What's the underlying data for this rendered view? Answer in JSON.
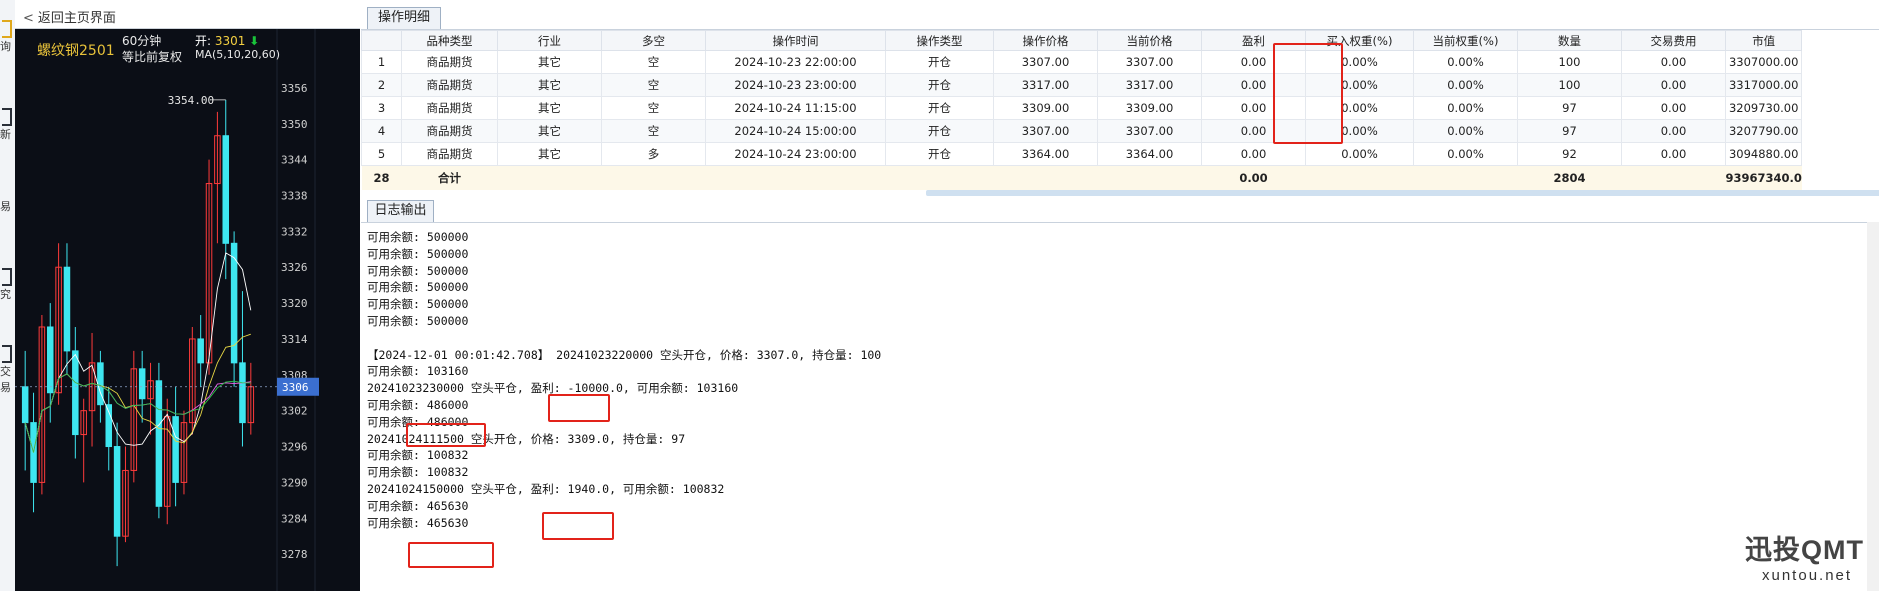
{
  "nav": {
    "back_label": "返回主页界面"
  },
  "sidebar": {
    "labels": [
      "询",
      "新",
      "易",
      "究",
      "交易"
    ]
  },
  "chart": {
    "symbol": "螺纹钢2501",
    "period": "60分钟",
    "adjust": "等比前复权",
    "open_label": "开:",
    "open_value": "3301",
    "open_arrow": "⬇",
    "ma_label": "MA(5,10,20,60)",
    "peak_label": "3354.00",
    "current_price_label": "3306",
    "colors": {
      "up": "#ff3b3b",
      "down": "#3ee6f0",
      "axis_text": "#d0d0d0",
      "current_box": "#3b6fd0"
    }
  },
  "chart_data": {
    "type": "candlestick",
    "title": "螺纹钢2501",
    "y_ticks": [
      3356,
      3350,
      3344,
      3338,
      3332,
      3326,
      3320,
      3314,
      3308,
      3302,
      3296,
      3290,
      3284,
      3278
    ],
    "ylim": [
      3273,
      3360
    ],
    "series_ma": [
      "MA5",
      "MA10",
      "MA20",
      "MA60"
    ],
    "candles": [
      {
        "o": 3306,
        "h": 3312,
        "l": 3292,
        "c": 3300
      },
      {
        "o": 3300,
        "h": 3305,
        "l": 3285,
        "c": 3290
      },
      {
        "o": 3290,
        "h": 3318,
        "l": 3288,
        "c": 3316
      },
      {
        "o": 3316,
        "h": 3320,
        "l": 3300,
        "c": 3305
      },
      {
        "o": 3305,
        "h": 3330,
        "l": 3303,
        "c": 3326
      },
      {
        "o": 3326,
        "h": 3330,
        "l": 3308,
        "c": 3312
      },
      {
        "o": 3312,
        "h": 3316,
        "l": 3294,
        "c": 3298
      },
      {
        "o": 3298,
        "h": 3304,
        "l": 3290,
        "c": 3302
      },
      {
        "o": 3302,
        "h": 3315,
        "l": 3296,
        "c": 3310
      },
      {
        "o": 3310,
        "h": 3312,
        "l": 3300,
        "c": 3303
      },
      {
        "o": 3303,
        "h": 3306,
        "l": 3292,
        "c": 3296
      },
      {
        "o": 3296,
        "h": 3300,
        "l": 3276,
        "c": 3281
      },
      {
        "o": 3281,
        "h": 3296,
        "l": 3280,
        "c": 3292
      },
      {
        "o": 3292,
        "h": 3312,
        "l": 3290,
        "c": 3309
      },
      {
        "o": 3309,
        "h": 3312,
        "l": 3300,
        "c": 3304
      },
      {
        "o": 3304,
        "h": 3310,
        "l": 3298,
        "c": 3307
      },
      {
        "o": 3307,
        "h": 3310,
        "l": 3284,
        "c": 3286
      },
      {
        "o": 3286,
        "h": 3304,
        "l": 3283,
        "c": 3301
      },
      {
        "o": 3301,
        "h": 3306,
        "l": 3286,
        "c": 3290
      },
      {
        "o": 3290,
        "h": 3302,
        "l": 3288,
        "c": 3300
      },
      {
        "o": 3300,
        "h": 3316,
        "l": 3298,
        "c": 3314
      },
      {
        "o": 3314,
        "h": 3318,
        "l": 3306,
        "c": 3310
      },
      {
        "o": 3310,
        "h": 3344,
        "l": 3308,
        "c": 3340
      },
      {
        "o": 3340,
        "h": 3352,
        "l": 3330,
        "c": 3348
      },
      {
        "o": 3348,
        "h": 3354,
        "l": 3324,
        "c": 3330
      },
      {
        "o": 3330,
        "h": 3332,
        "l": 3306,
        "c": 3310
      },
      {
        "o": 3310,
        "h": 3322,
        "l": 3296,
        "c": 3300
      },
      {
        "o": 3300,
        "h": 3310,
        "l": 3298,
        "c": 3306
      }
    ]
  },
  "ops": {
    "tab_label": "操作明细",
    "columns": [
      "",
      "品种类型",
      "行业",
      "多空",
      "操作时间",
      "操作类型",
      "操作价格",
      "当前价格",
      "盈利",
      "买入权重(%)",
      "当前权重(%)",
      "数量",
      "交易费用",
      "市值"
    ],
    "rows": [
      [
        "1",
        "商品期货",
        "其它",
        "空",
        "2024-10-23 22:00:00",
        "开仓",
        "3307.00",
        "3307.00",
        "0.00",
        "0.00%",
        "0.00%",
        "100",
        "0.00",
        "3307000.00"
      ],
      [
        "2",
        "商品期货",
        "其它",
        "空",
        "2024-10-23 23:00:00",
        "开仓",
        "3317.00",
        "3317.00",
        "0.00",
        "0.00%",
        "0.00%",
        "100",
        "0.00",
        "3317000.00"
      ],
      [
        "3",
        "商品期货",
        "其它",
        "空",
        "2024-10-24 11:15:00",
        "开仓",
        "3309.00",
        "3309.00",
        "0.00",
        "0.00%",
        "0.00%",
        "97",
        "0.00",
        "3209730.00"
      ],
      [
        "4",
        "商品期货",
        "其它",
        "空",
        "2024-10-24 15:00:00",
        "开仓",
        "3307.00",
        "3307.00",
        "0.00",
        "0.00%",
        "0.00%",
        "97",
        "0.00",
        "3207790.00"
      ],
      [
        "5",
        "商品期货",
        "其它",
        "多",
        "2024-10-24 23:00:00",
        "开仓",
        "3364.00",
        "3364.00",
        "0.00",
        "0.00%",
        "0.00%",
        "92",
        "0.00",
        "3094880.00"
      ]
    ],
    "total": {
      "index": "28",
      "label": "合计",
      "profit": "0.00",
      "quantity": "2804",
      "market_value": "93967340.0"
    }
  },
  "log": {
    "tab_label": "日志输出",
    "lines": [
      "可用余额: 500000",
      "可用余额: 500000",
      "可用余额: 500000",
      "可用余额: 500000",
      "可用余额: 500000",
      "可用余额: 500000",
      "",
      "【2024-12-01 00:01:42.708】  20241023220000 空头开仓, 价格: 3307.0, 持仓量: 100",
      "可用余额: 103160",
      "20241023230000 空头平仓, 盈利: -10000.0, 可用余额: 103160",
      "可用余额: 486000",
      "可用余额: 486000",
      "20241024111500 空头开仓, 价格: 3309.0, 持仓量: 97",
      "可用余额: 100832",
      "可用余额: 100832",
      "20241024150000 空头平仓, 盈利: 1940.0, 可用余额: 100832",
      "可用余额: 465630",
      "可用余额: 465630"
    ]
  },
  "watermark": {
    "brand": "迅投QMT",
    "url": "xuntou.net"
  }
}
